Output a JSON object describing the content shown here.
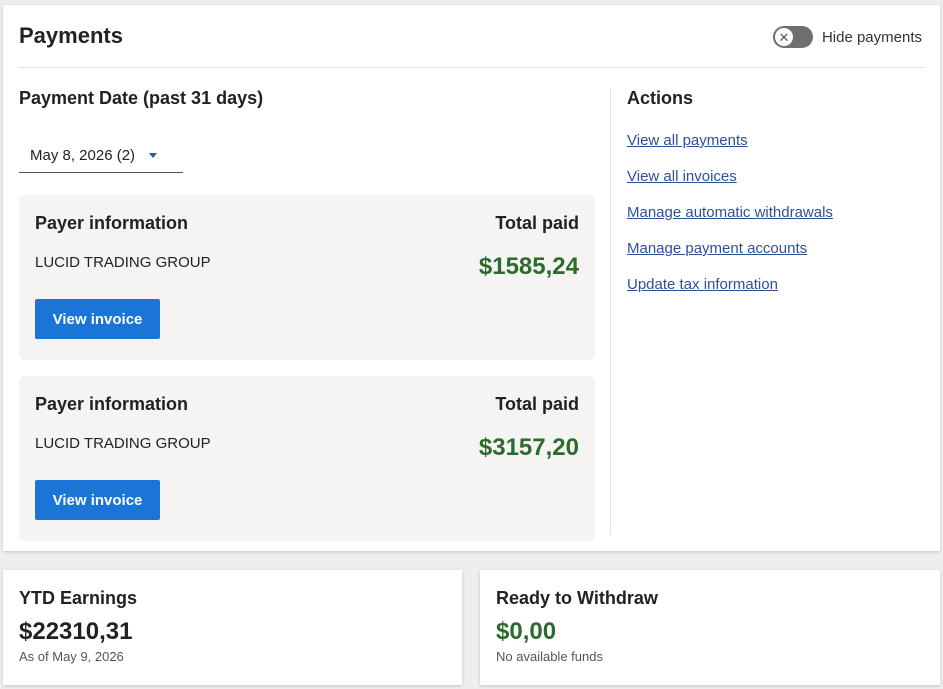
{
  "header": {
    "title": "Payments",
    "toggle_label": "Hide payments",
    "toggle_icon": "x-icon"
  },
  "payment_date": {
    "title": "Payment Date (past 31 days)",
    "selected": "May 8, 2026 (2)"
  },
  "payments": [
    {
      "payer_label": "Payer information",
      "total_label": "Total paid",
      "payer": "LUCID TRADING GROUP",
      "amount": "$1585,24",
      "button": "View invoice"
    },
    {
      "payer_label": "Payer information",
      "total_label": "Total paid",
      "payer": "LUCID TRADING GROUP",
      "amount": "$3157,20",
      "button": "View invoice"
    }
  ],
  "actions": {
    "title": "Actions",
    "links": [
      "View all payments",
      "View all invoices",
      "Manage automatic withdrawals",
      "Manage payment accounts",
      "Update tax information"
    ]
  },
  "ytd": {
    "title": "YTD Earnings",
    "amount": "$22310,31",
    "note": "As of May 9, 2026"
  },
  "withdraw": {
    "title": "Ready to Withdraw",
    "amount": "$0,00",
    "note": "No available funds"
  },
  "colors": {
    "accent_button": "#1b75d6",
    "amount_green": "#2d6a2e",
    "link_blue": "#2f4f9a"
  }
}
